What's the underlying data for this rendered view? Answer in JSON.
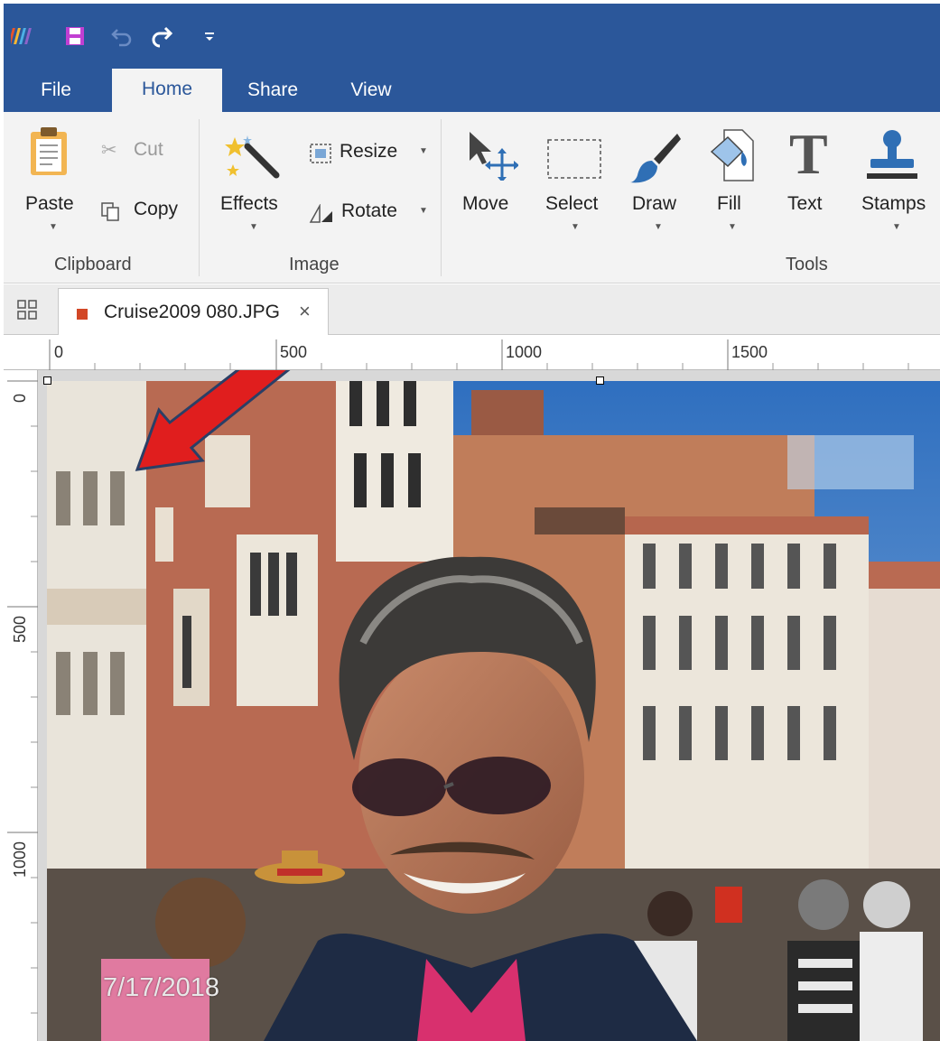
{
  "window": {
    "tabs": [
      {
        "label": "File"
      },
      {
        "label": "Home"
      },
      {
        "label": "Share"
      },
      {
        "label": "View"
      }
    ]
  },
  "ribbon": {
    "clipboard": {
      "group_label": "Clipboard",
      "paste": "Paste",
      "cut": "Cut",
      "copy": "Copy"
    },
    "image": {
      "group_label": "Image",
      "effects": "Effects",
      "resize": "Resize",
      "rotate": "Rotate"
    },
    "tools": {
      "group_label": "Tools",
      "move": "Move",
      "select": "Select",
      "draw": "Draw",
      "fill": "Fill",
      "text": "Text",
      "stamps": "Stamps"
    }
  },
  "document": {
    "tab_name": "Cruise2009 080.JPG",
    "close_glyph": "×"
  },
  "rulers": {
    "horizontal": [
      "0",
      "500",
      "1000",
      "1500"
    ],
    "vertical": [
      "0",
      "500",
      "1000"
    ]
  },
  "annotation": {
    "date": "7/17/2018",
    "arrow_color": "#e01e1e"
  },
  "colors": {
    "title_bar": "#2b579a",
    "ribbon": "#f3f3f3"
  }
}
